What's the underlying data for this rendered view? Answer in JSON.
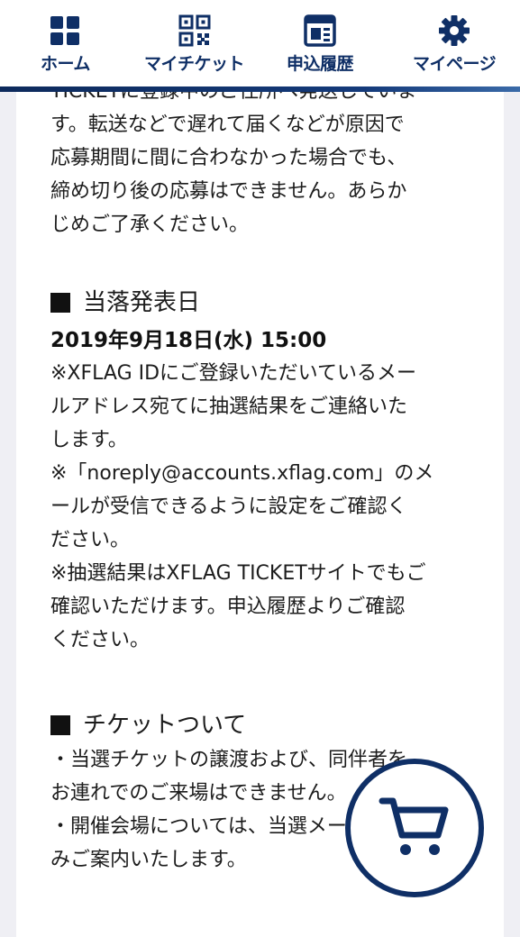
{
  "nav": {
    "items": [
      {
        "label": "ホーム",
        "icon": "home-grid-icon"
      },
      {
        "label": "マイチケット",
        "icon": "qr-code-icon"
      },
      {
        "label": "申込履歴",
        "icon": "history-icon"
      },
      {
        "label": "マイページ",
        "icon": "gear-icon"
      }
    ],
    "color": "#0f2f66"
  },
  "content": {
    "intro_lines": [
      "TICKETに登録中のご住所へ発送していま",
      "す。転送などで遅れて届くなどが原因で",
      "応募期間に間に合わなかった場合でも、",
      "締め切り後の応募はできません。あらか",
      "じめご了承ください。"
    ],
    "announcement": {
      "heading": "当落発表日",
      "date": "2019年9月18日(水) 15:00",
      "lines": [
        "※XFLAG IDにご登録いただいているメー",
        "ルアドレス宛てに抽選結果をご連絡いた",
        "します。",
        "※「noreply@accounts.xflag.com」のメ",
        "ールが受信できるように設定をご確認く",
        "ださい。",
        "※抽選結果はXFLAG TICKETサイトでもご",
        "確認いただけます。申込履歴よりご確認",
        "ください。"
      ]
    },
    "ticket": {
      "heading": "チケットついて",
      "lines": [
        "・当選チケットの譲渡および、同伴者を",
        "お連れでのご来場はできません。",
        "・開催会場については、当選メールでの",
        "みご案内いたします。"
      ]
    }
  },
  "cart": {
    "icon": "cart-icon"
  }
}
